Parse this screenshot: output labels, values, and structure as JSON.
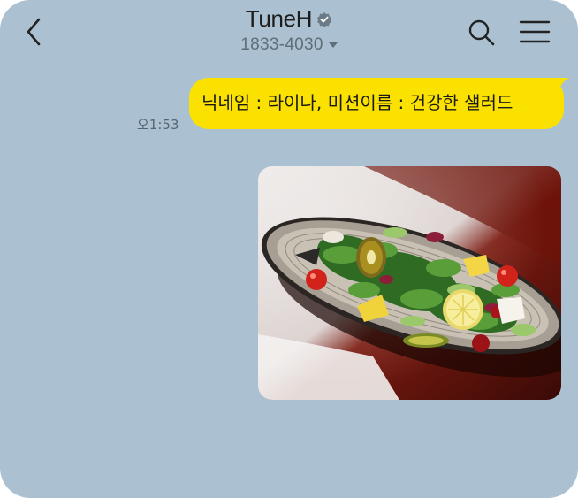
{
  "header": {
    "title": "TuneH",
    "phone": "1833-4030",
    "back_icon": "chevron-left-icon",
    "verified_icon": "verified-badge-icon",
    "search_icon": "search-icon",
    "menu_icon": "hamburger-menu-icon"
  },
  "messages": [
    {
      "type": "text",
      "text": "닉네임 : 라이나, 미션이름 :  건강한 샐러드",
      "time": "오1:53",
      "bubble_color": "#fae100"
    },
    {
      "type": "image",
      "subject": "salad-photo"
    }
  ],
  "colors": {
    "background": "#abc1d1",
    "bubble": "#fae100",
    "verified": "#6b7a86"
  }
}
